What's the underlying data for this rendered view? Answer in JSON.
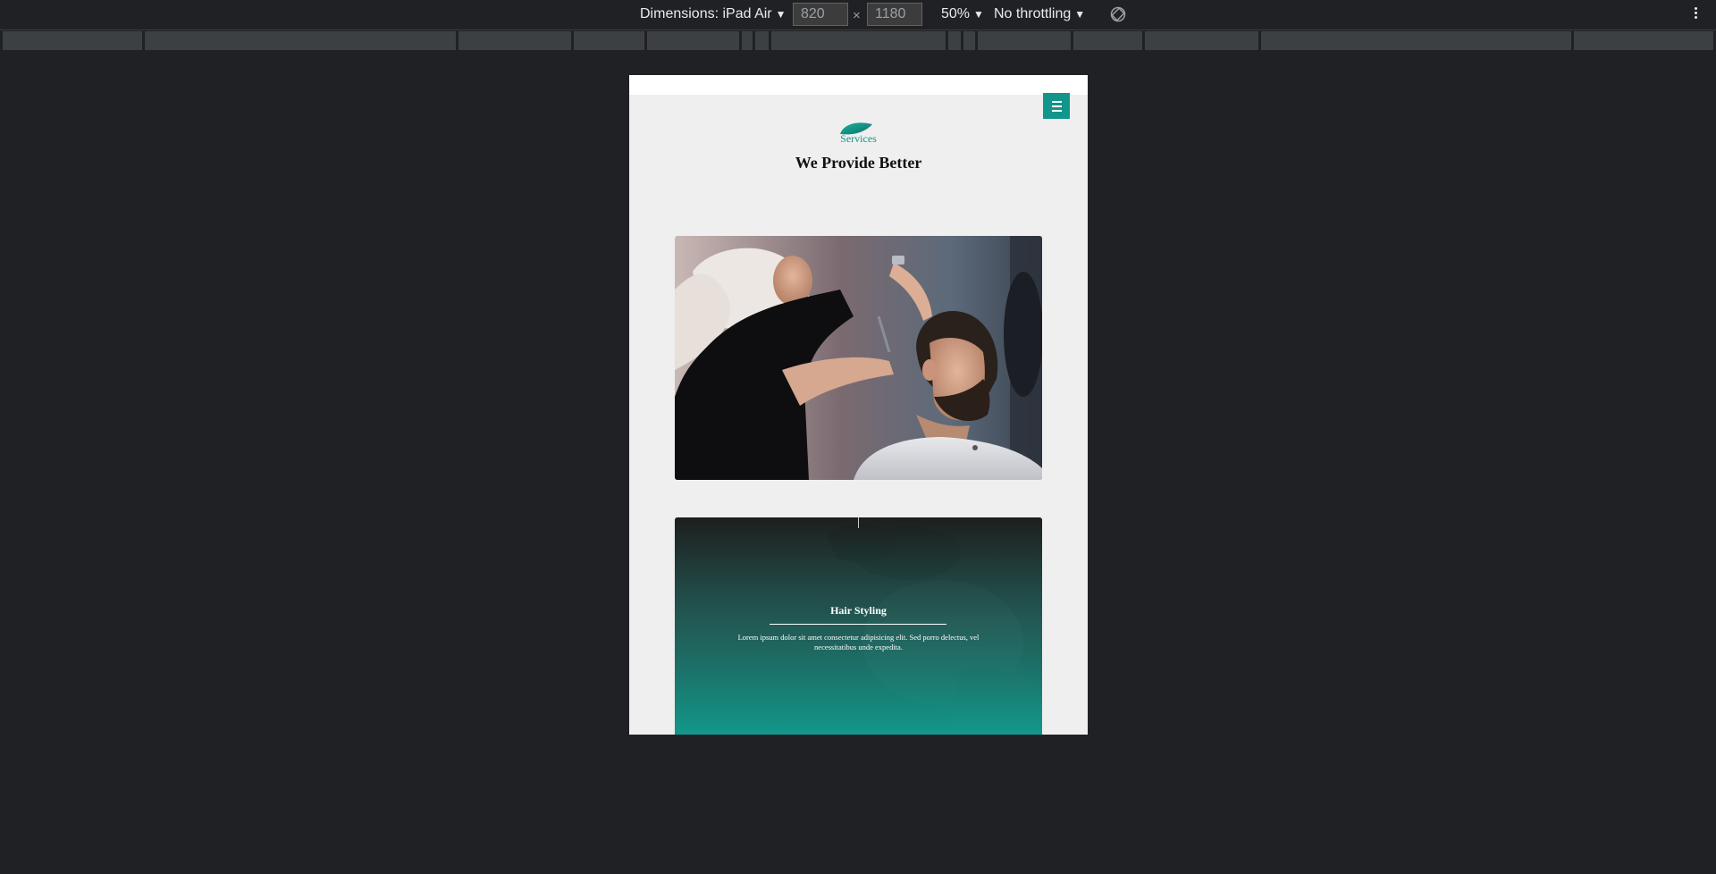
{
  "devtools": {
    "dimensions_label": "Dimensions: iPad Air",
    "width_value": "820",
    "height_value": "1180",
    "zoom_label": "50%",
    "throttle_label": "No throttling",
    "dropdown_arrow": "▼",
    "times_glyph": "×"
  },
  "page": {
    "services_label": "Services",
    "section_title": "We Provide Better",
    "accent_color": "#12958a",
    "cards": [
      {
        "image": "stylist-cutting-mans-hair-photo"
      },
      {
        "title": "Hair Styling",
        "text": "Lorem ipsum dolor sit amet consectetur adipisicing elit. Sed porro delectus, vel necessitatibus unde expedita."
      }
    ]
  }
}
